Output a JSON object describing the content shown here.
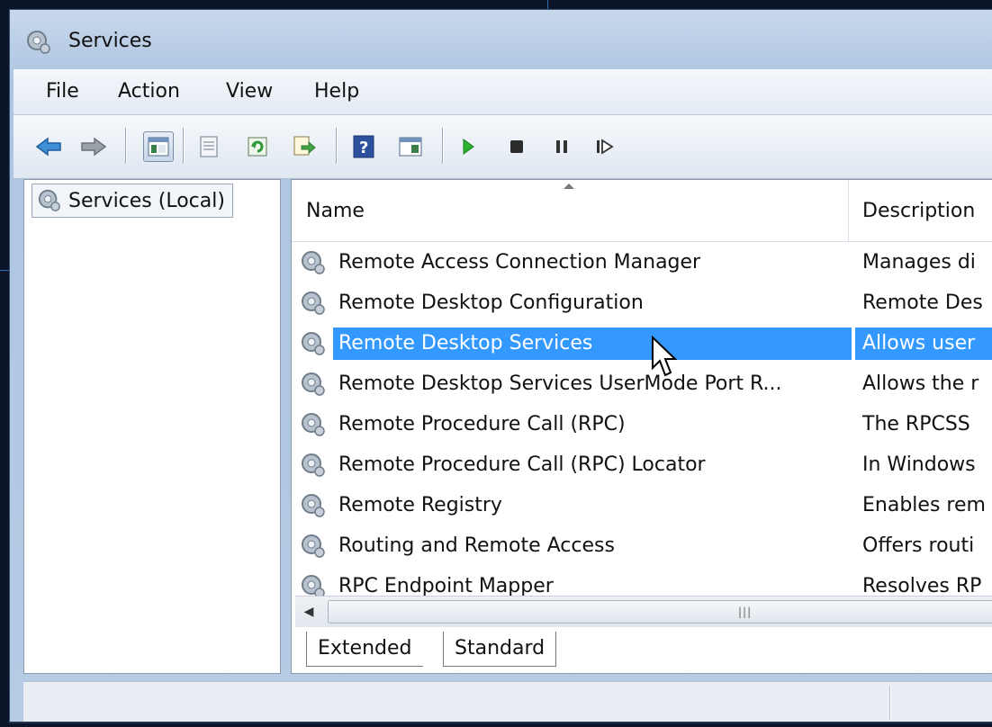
{
  "window": {
    "title": "Services"
  },
  "menu": [
    "File",
    "Action",
    "View",
    "Help"
  ],
  "toolbar": [
    "back-icon",
    "forward-icon",
    "show-hide-tree-icon",
    "properties-icon",
    "refresh-icon",
    "export-list-icon",
    "help-icon",
    "show-hide-action-pane-icon",
    "start-service-icon",
    "stop-service-icon",
    "pause-service-icon",
    "resume-service-icon"
  ],
  "tree": {
    "root": "Services (Local)"
  },
  "table": {
    "columns": [
      "Name",
      "Description"
    ],
    "rows": [
      {
        "name": "Remote Access Connection Manager",
        "description": "Manages di"
      },
      {
        "name": "Remote Desktop Configuration",
        "description": "Remote Des"
      },
      {
        "name": "Remote Desktop Services",
        "description": "Allows user"
      },
      {
        "name": "Remote Desktop Services UserMode Port R...",
        "description": "Allows the r"
      },
      {
        "name": "Remote Procedure Call (RPC)",
        "description": "The RPCSS"
      },
      {
        "name": "Remote Procedure Call (RPC) Locator",
        "description": "In Windows"
      },
      {
        "name": "Remote Registry",
        "description": "Enables rem"
      },
      {
        "name": "Routing and Remote Access",
        "description": "Offers routi"
      },
      {
        "name": "RPC Endpoint Mapper",
        "description": "Resolves RP"
      }
    ],
    "selected_index": 2
  },
  "tabs": [
    "Extended",
    "Standard"
  ],
  "active_tab": "Standard",
  "colors": {
    "selection": "#3399ff",
    "titlebar": "#b9cde6"
  }
}
